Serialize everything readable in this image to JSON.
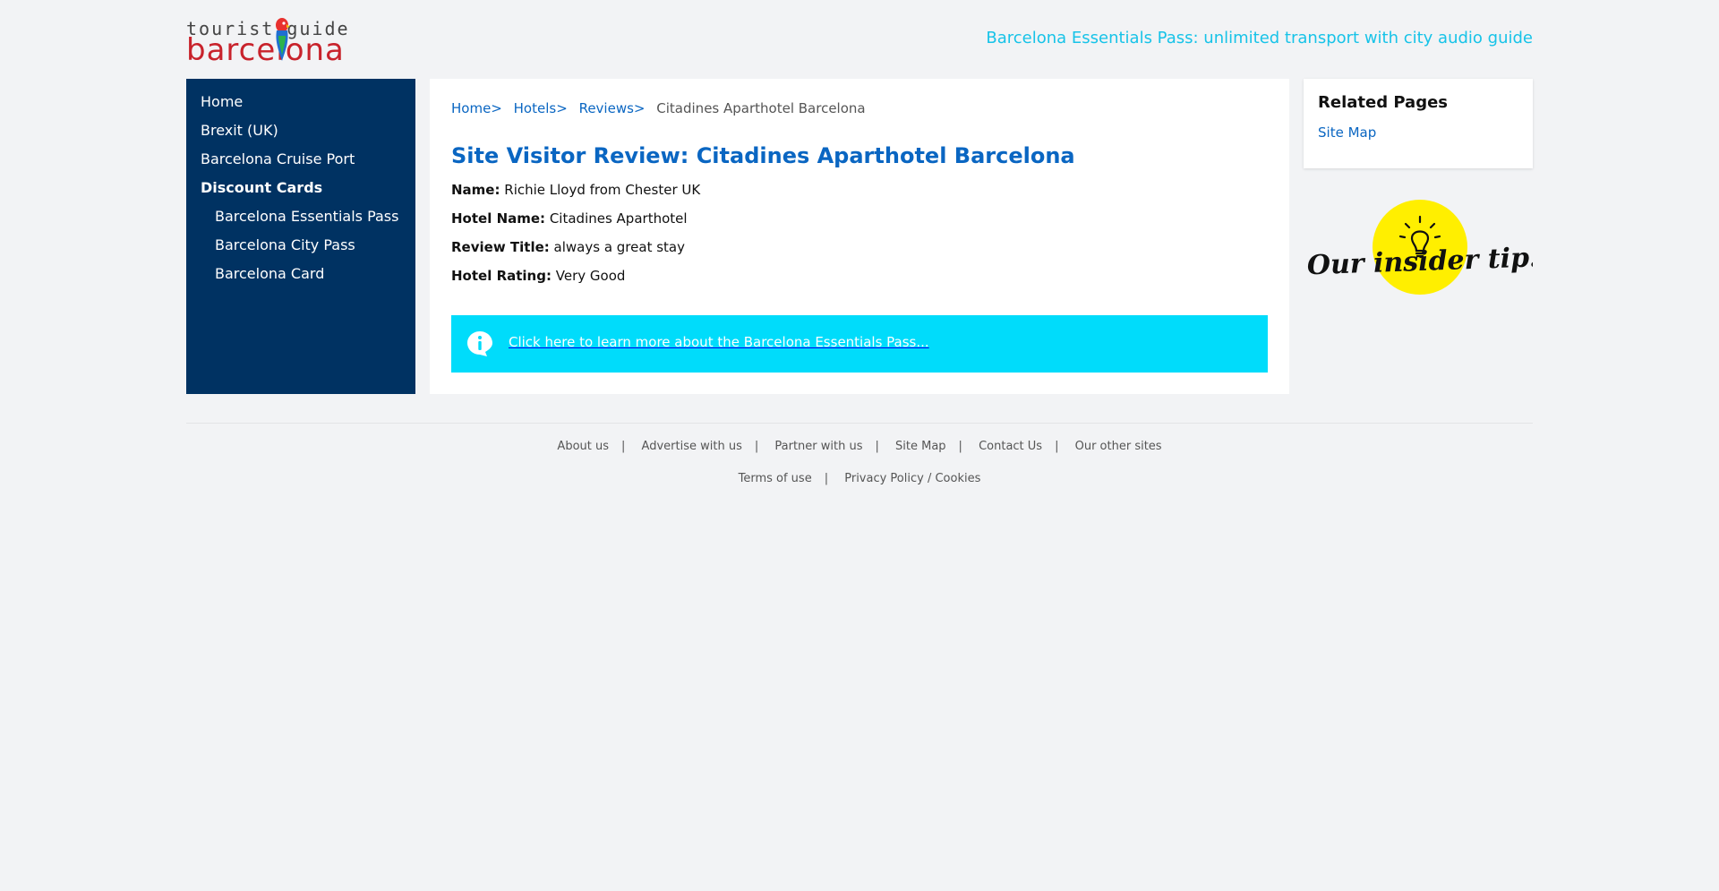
{
  "header": {
    "logo_text_top": "tourist guide",
    "logo_text_bottom": "barcelona",
    "promo_link": "Barcelona Essentials Pass: unlimited transport with city audio guide"
  },
  "sidebar": {
    "items": [
      {
        "label": "Home"
      },
      {
        "label": "Brexit (UK)"
      },
      {
        "label": "Barcelona Cruise Port"
      },
      {
        "label": "Discount Cards"
      },
      {
        "label": "Barcelona Essentials Pass"
      },
      {
        "label": "Barcelona City Pass"
      },
      {
        "label": "Barcelona Card"
      }
    ]
  },
  "breadcrumb": {
    "items": [
      "Home",
      "Hotels",
      "Reviews"
    ],
    "separator": ">",
    "current": "Citadines Aparthotel Barcelona"
  },
  "main": {
    "title": "Site Visitor Review: Citadines Aparthotel Barcelona",
    "fields": [
      {
        "label": "Name:",
        "value": "Richie Lloyd from Chester UK"
      },
      {
        "label": "Hotel Name:",
        "value": "Citadines Aparthotel"
      },
      {
        "label": "Review Title:",
        "value": "always a great stay"
      },
      {
        "label": "Hotel Rating:",
        "value": "Very Good"
      }
    ],
    "info_banner": "Click here to learn more about the Barcelona Essentials Pass...",
    "info_icon": "info-icon"
  },
  "related": {
    "title": "Related Pages",
    "link": "Site Map"
  },
  "tip": {
    "text": "Our insider tip!",
    "icon": "lightbulb-icon"
  },
  "footer": {
    "row1": [
      "About us",
      "Advertise with us",
      "Partner with us",
      "Site Map",
      "Contact Us",
      "Our other sites"
    ],
    "row2": [
      "Terms of use",
      "Privacy Policy / Cookies"
    ],
    "separator": "|"
  },
  "colors": {
    "background": "#f2f3f5",
    "sidebar": "#003262",
    "link": "#0a66c2",
    "promo": "#17c3e8",
    "banner": "#00dcfb",
    "logo_red": "#c8232c",
    "tip_yellow": "#ffef00"
  }
}
